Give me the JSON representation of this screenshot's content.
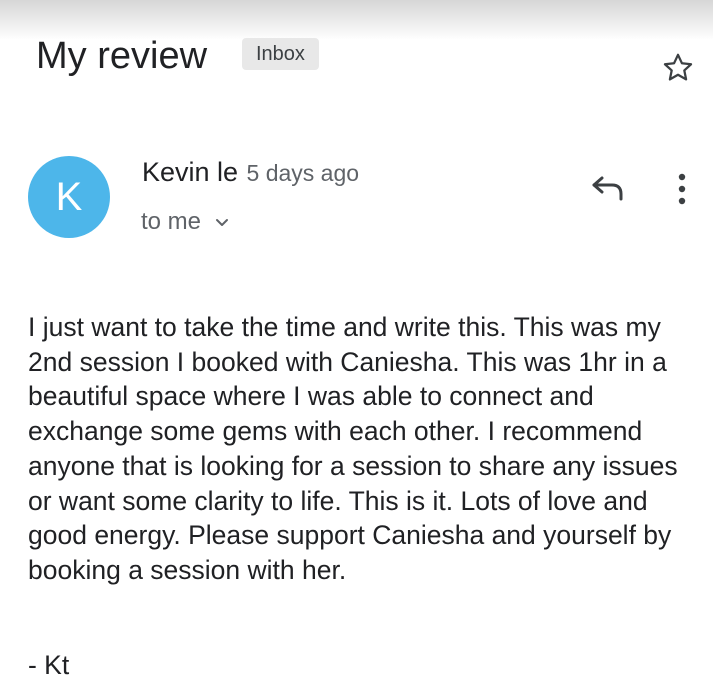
{
  "email": {
    "subject": "My review",
    "label": "Inbox",
    "sender": {
      "avatar_letter": "K",
      "name": "Kevin le",
      "time": "5 days ago",
      "recipient": "to me"
    },
    "body": "I just want to take the time and write this. This was my 2nd session I booked with Caniesha. This was 1hr in a beautiful space where I was able to connect and exchange some gems with each other. I recommend anyone that is looking for a session to share any issues or want some clarity to life. This is it. Lots of love and good energy. Please support Caniesha and yourself by booking a session with her.",
    "signature": "- Kt"
  },
  "icons": {
    "star": "star-icon",
    "reply": "reply-icon",
    "more": "more-vert-icon",
    "expand": "chevron-down-icon"
  },
  "colors": {
    "avatar": "#4db6ea",
    "text": "#202124",
    "secondary_text": "#5f6368",
    "chip_background": "#e8e8e8"
  }
}
